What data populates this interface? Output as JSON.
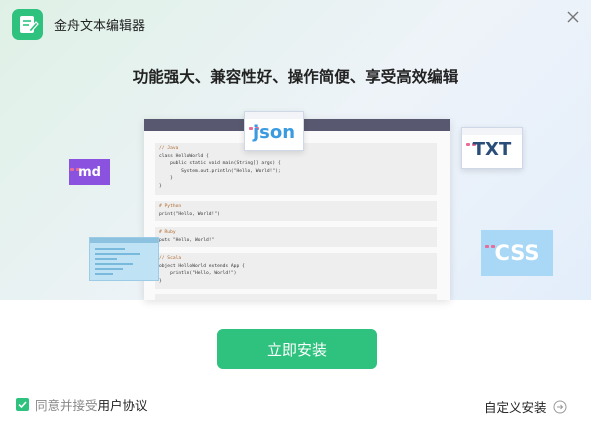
{
  "app": {
    "title": "金舟文本编辑器"
  },
  "hero": {
    "headline": "功能强大、兼容性好、操作简便、享受高效编辑"
  },
  "tags": {
    "json": "json",
    "txt": "TXT",
    "md": "md",
    "css": "CSS"
  },
  "code_blocks": [
    {
      "comment": "// Java",
      "lines": [
        "class HelloWorld {",
        "    public static void main(String[] args) {",
        "        System.out.println(\"Hello, World!\");",
        "    }",
        "}"
      ]
    },
    {
      "comment": "# Python",
      "lines": [
        "print(\"Hello, World!\")"
      ]
    },
    {
      "comment": "# Ruby",
      "lines": [
        "puts \"Hello, World!\""
      ]
    },
    {
      "comment": "// Scala",
      "lines": [
        "object HelloWorld extends App {",
        "    println(\"Hello, World!\")",
        "}"
      ]
    }
  ],
  "install": {
    "button_label": "立即安装"
  },
  "agreement": {
    "prefix": "同意并接受",
    "link": "用户协议",
    "checked": true
  },
  "custom_install": {
    "label": "自定义安装"
  },
  "colors": {
    "accent": "#2ec27e",
    "md_tag": "#8b52e0",
    "css_tag": "#a9d8f7",
    "json_text": "#3a9be0",
    "editor_bar": "#585870"
  }
}
